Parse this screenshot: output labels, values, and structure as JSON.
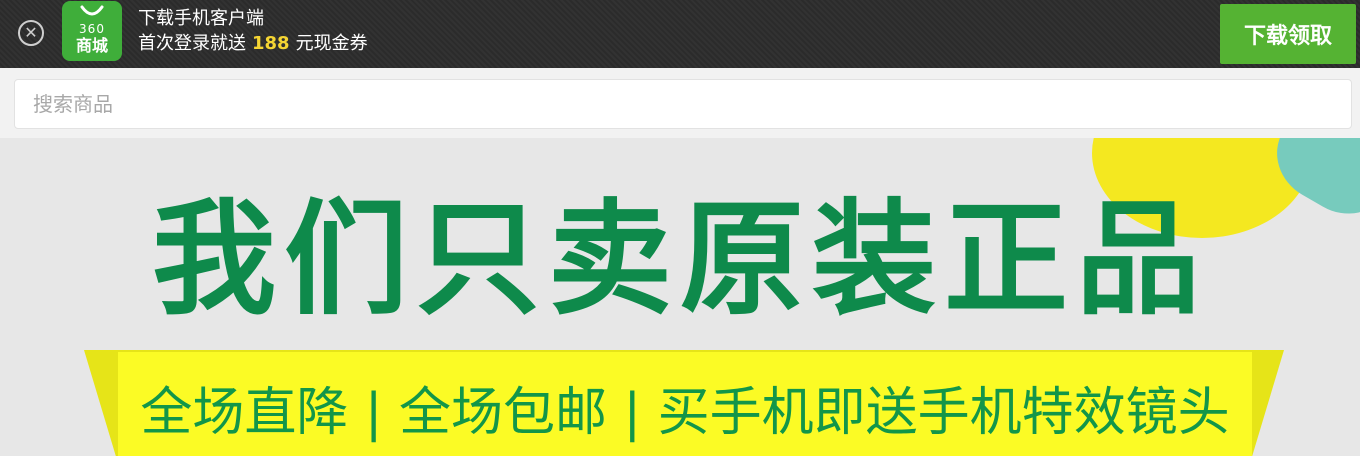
{
  "download_bar": {
    "logo_line1": "360",
    "logo_line2": "商城",
    "title": "下载手机客户端",
    "subtitle_before": "首次登录就送",
    "subtitle_amount": "188",
    "subtitle_after": "元现金券",
    "button_label": "下载领取",
    "close_icon": "close-icon"
  },
  "search": {
    "placeholder": "搜索商品",
    "value": ""
  },
  "banner": {
    "headline": "我们只卖原装正品",
    "strip_text": "全场直降 | 全场包邮 | 买手机即送手机特效镜头",
    "colors": {
      "headline": "#0e8a4b",
      "strip": "#fbfb25",
      "strip_text": "#129649",
      "background": "#e7e7e7"
    }
  },
  "colors": {
    "accent": "#55b333",
    "amount": "#f5d533",
    "topbar": "#2b2b2b"
  }
}
